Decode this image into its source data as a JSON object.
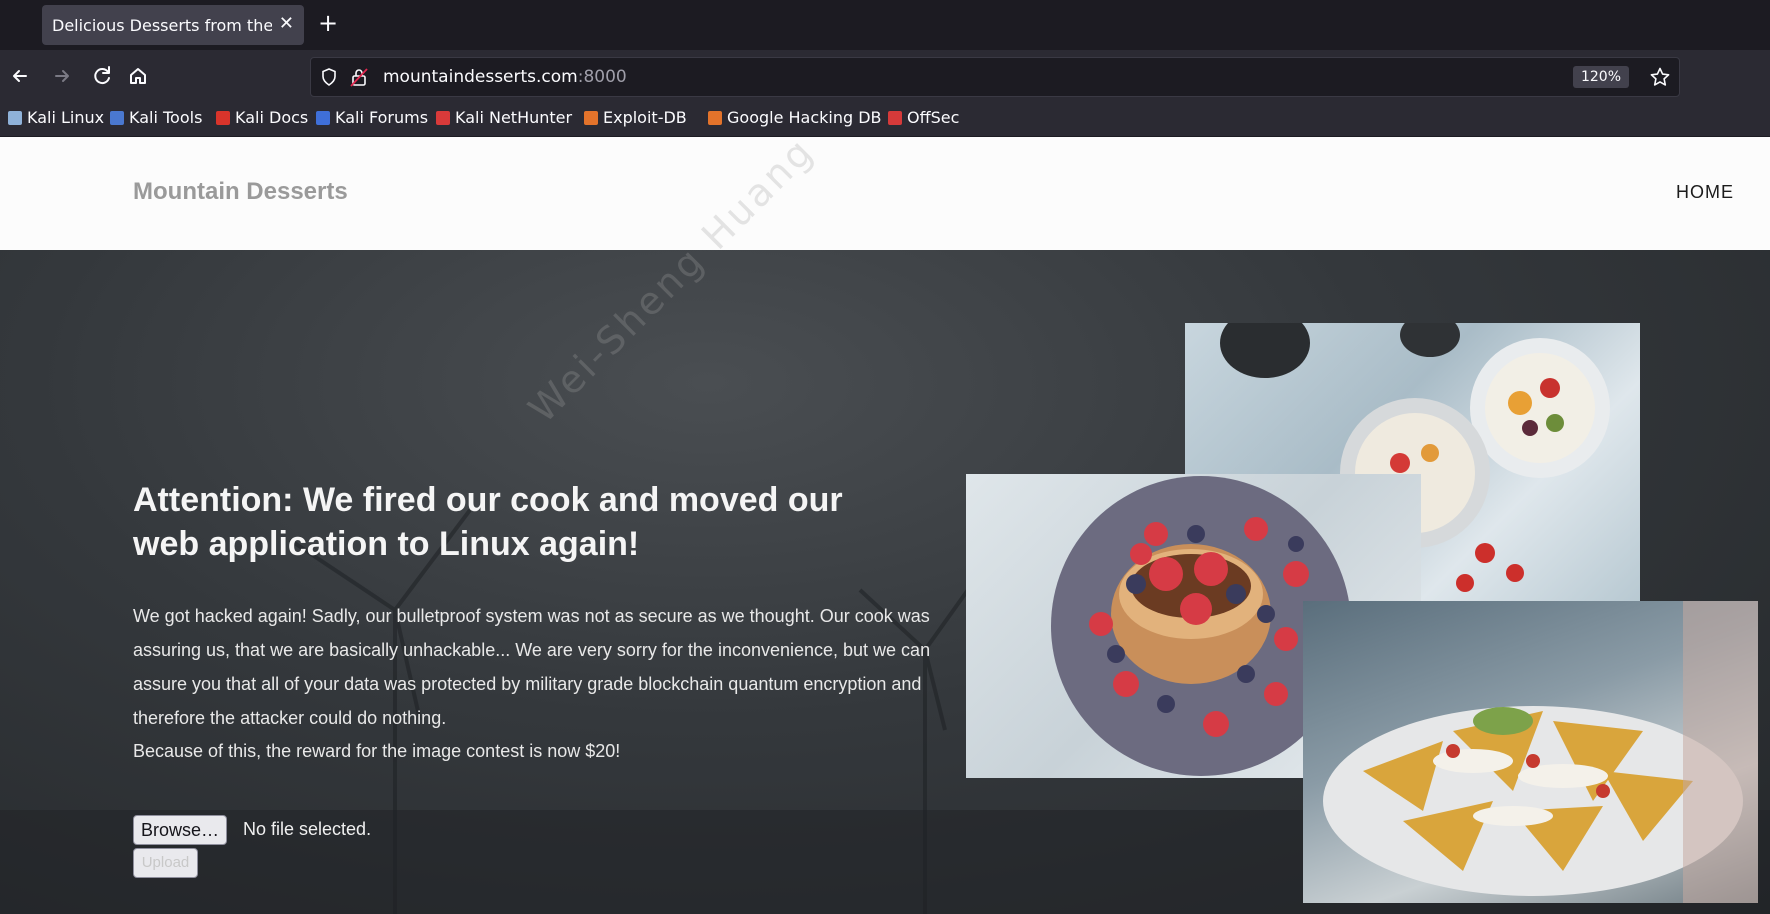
{
  "browser": {
    "tab_title": "Delicious Desserts from the Mountains",
    "tab_close": "✕",
    "new_tab": "+",
    "url_host": "mountaindesserts.com",
    "url_port": ":8000",
    "zoom": "120%",
    "bookmarks": [
      {
        "label": "Kali Linux",
        "color": "#8fb2d9"
      },
      {
        "label": "Kali Tools",
        "color": "#4a78d0"
      },
      {
        "label": "Kali Docs",
        "color": "#d9342b"
      },
      {
        "label": "Kali Forums",
        "color": "#3f6fd8"
      },
      {
        "label": "Kali NetHunter",
        "color": "#d93a3a"
      },
      {
        "label": "Exploit-DB",
        "color": "#e3732b"
      },
      {
        "label": "Google Hacking DB",
        "color": "#e3732b"
      },
      {
        "label": "OffSec",
        "color": "#d63a3a"
      }
    ]
  },
  "site": {
    "brand": "Mountain Desserts",
    "nav_home": "HOME",
    "headline": "Attention: We fired our cook and moved our web application to Linux again!",
    "paragraph": "We got hacked again! Sadly, our bulletproof system was not as secure as we thought. Our cook was assuring us, that we are basically unhackable... We are very sorry for the inconvenience, but we can assure you that all of your data was protected by military grade blockchain quantum encryption and therefore the attacker could do nothing.",
    "reward_line": "Because of this, the reward for the image contest is now $20!",
    "browse_label": "Browse…",
    "no_file": "No file selected.",
    "upload_label": "Upload"
  },
  "watermark": "Wei-Sheng Huang"
}
